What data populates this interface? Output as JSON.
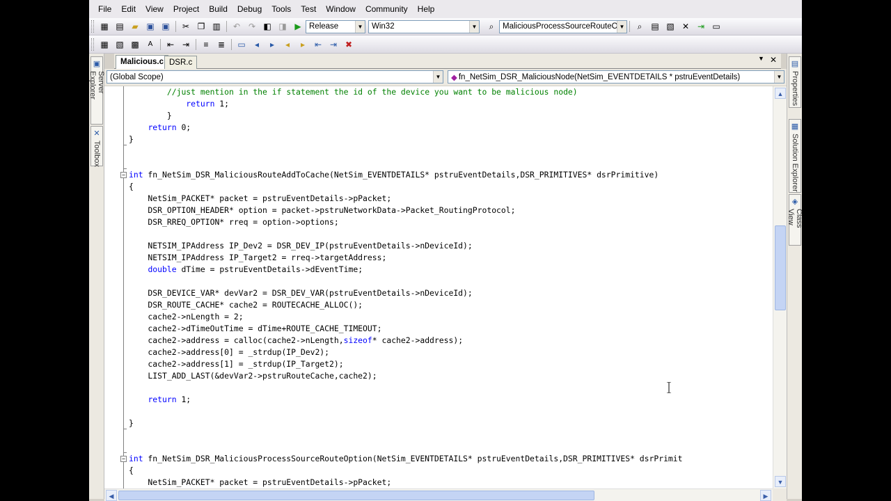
{
  "menu": [
    "File",
    "Edit",
    "View",
    "Project",
    "Build",
    "Debug",
    "Tools",
    "Test",
    "Window",
    "Community",
    "Help"
  ],
  "toolbar": {
    "configuration": "Release",
    "platform": "Win32",
    "find_combo": "MaliciousProcessSourceRouteOptic"
  },
  "tabs": [
    {
      "label": "Malicious.c",
      "active": true
    },
    {
      "label": "DSR.c",
      "active": false
    }
  ],
  "dock_left": [
    "Server Explorer",
    "Toolbox"
  ],
  "dock_right": [
    "Properties",
    "Solution Explorer",
    "Class View"
  ],
  "scope": {
    "left": "(Global Scope)",
    "right": "fn_NetSim_DSR_MaliciousNode(NetSim_EVENTDETAILS * pstruEventDetails)"
  },
  "code": [
    "        //just mention in the if statement the id of the device you want to be malicious node)",
    "            return 1;",
    "        }",
    "    return 0;",
    "}",
    "",
    "",
    "int fn_NetSim_DSR_MaliciousRouteAddToCache(NetSim_EVENTDETAILS* pstruEventDetails,DSR_PRIMITIVES* dsrPrimitive)",
    "{",
    "    NetSim_PACKET* packet = pstruEventDetails->pPacket;",
    "    DSR_OPTION_HEADER* option = packet->pstruNetworkData->Packet_RoutingProtocol;",
    "    DSR_RREQ_OPTION* rreq = option->options;",
    "",
    "    NETSIM_IPAddress IP_Dev2 = DSR_DEV_IP(pstruEventDetails->nDeviceId);",
    "    NETSIM_IPAddress IP_Target2 = rreq->targetAddress;",
    "    double dTime = pstruEventDetails->dEventTime;",
    "",
    "    DSR_DEVICE_VAR* devVar2 = DSR_DEV_VAR(pstruEventDetails->nDeviceId);",
    "    DSR_ROUTE_CACHE* cache2 = ROUTECACHE_ALLOC();",
    "    cache2->nLength = 2;",
    "    cache2->dTimeOutTime = dTime+ROUTE_CACHE_TIMEOUT;",
    "    cache2->address = calloc(cache2->nLength,sizeof* cache2->address);",
    "    cache2->address[0] = _strdup(IP_Dev2);",
    "    cache2->address[1] = _strdup(IP_Target2);",
    "    LIST_ADD_LAST(&devVar2->pstruRouteCache,cache2);",
    "",
    "    return 1;",
    "",
    "}",
    "",
    "",
    "int fn_NetSim_DSR_MaliciousProcessSourceRouteOption(NetSim_EVENTDETAILS* pstruEventDetails,DSR_PRIMITIVES* dsrPrimit",
    "{",
    "    NetSim_PACKET* packet = pstruEventDetails->pPacket;"
  ],
  "colors": {
    "keyword": "#0000ff",
    "comment": "#008000",
    "chrome": "#d4d0c8"
  }
}
